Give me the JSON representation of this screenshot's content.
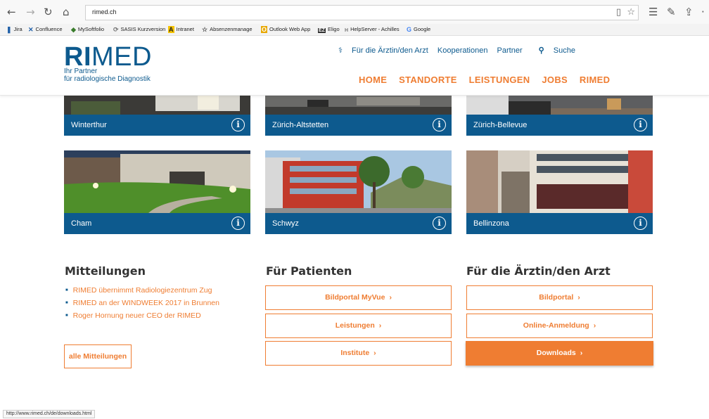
{
  "browser": {
    "url": "rimed.ch",
    "bookmarks": [
      "Jira",
      "Confluence",
      "MySoftfolio",
      "SASIS Kurzversion",
      "Intranet",
      "Absenzenmanage",
      "Outlook Web App",
      "Eligo",
      "HelpServer - Achilles",
      "Google"
    ],
    "status_url": "http://www.rimed.ch/de/downloads.html"
  },
  "header": {
    "logo_ri": "RI",
    "logo_med": "MED",
    "tagline_line1": "Ihr Partner",
    "tagline_line2": "für radiologische Diagnostik",
    "top_links": [
      "Für die Ärztin/den Arzt",
      "Kooperationen",
      "Partner",
      "Suche"
    ],
    "nav": [
      "HOME",
      "STANDORTE",
      "LEISTUNGEN",
      "JOBS",
      "RIMED"
    ]
  },
  "locations": [
    "Winterthur",
    "Zürich-Altstetten",
    "Zürich-Bellevue",
    "Cham",
    "Schwyz",
    "Bellinzona"
  ],
  "news": {
    "title": "Mitteilungen",
    "items": [
      "RIMED übernimmt Radiologiezentrum Zug",
      "RIMED an der WINDWEEK 2017 in Brunnen",
      "Roger Hornung neuer CEO der RIMED"
    ],
    "all_label": "alle Mitteilungen"
  },
  "patients": {
    "title": "Für Patienten",
    "buttons": [
      "Bildportal MyVue",
      "Leistungen",
      "Institute"
    ]
  },
  "doctors": {
    "title": "Für die Ärztin/den Arzt",
    "buttons": [
      "Bildportal",
      "Online-Anmeldung",
      "Downloads"
    ]
  },
  "colors": {
    "brand_blue": "#0d5a8e",
    "accent_orange": "#ef7d32"
  }
}
